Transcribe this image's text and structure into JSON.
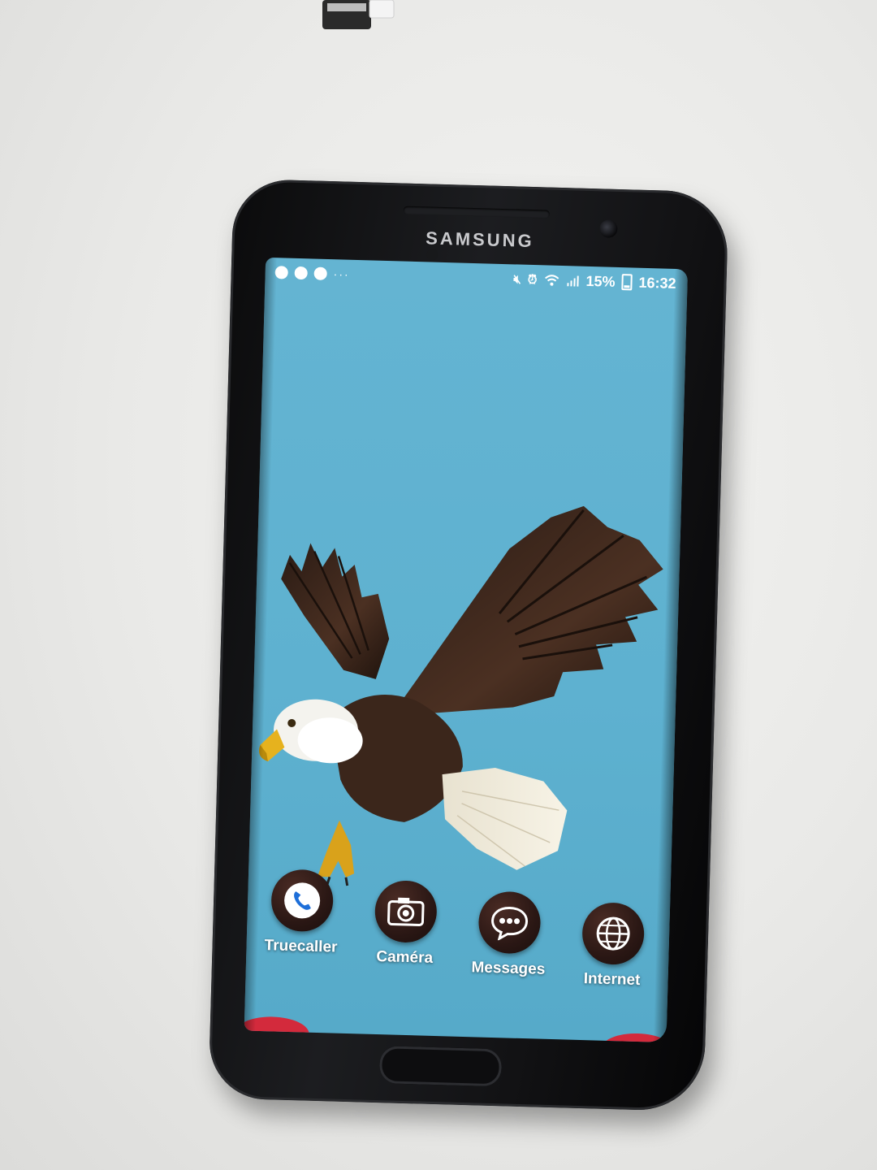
{
  "phone": {
    "brand": "SAMSUNG"
  },
  "statusbar": {
    "left_icons": [
      "notification-icon",
      "truecaller-icon",
      "phone-icon"
    ],
    "more": "···",
    "battery": "15%",
    "time": "16:32",
    "right_icons": [
      "mute-icon",
      "alarm-icon",
      "wifi-icon",
      "signal-icon",
      "battery-icon"
    ]
  },
  "wallpaper": {
    "background_color": "#5eb1d0",
    "subject": "eagle"
  },
  "dock": {
    "apps": [
      {
        "label": "Truecaller",
        "icon": "phone-handset-icon"
      },
      {
        "label": "Caméra",
        "icon": "camera-icon"
      },
      {
        "label": "Messages",
        "icon": "chat-bubble-icon"
      },
      {
        "label": "Internet",
        "icon": "globe-icon"
      }
    ]
  },
  "colors": {
    "screen_bg": "#5eb1d0",
    "phone_body": "#111214",
    "nav_accent": "#d32a3c"
  }
}
